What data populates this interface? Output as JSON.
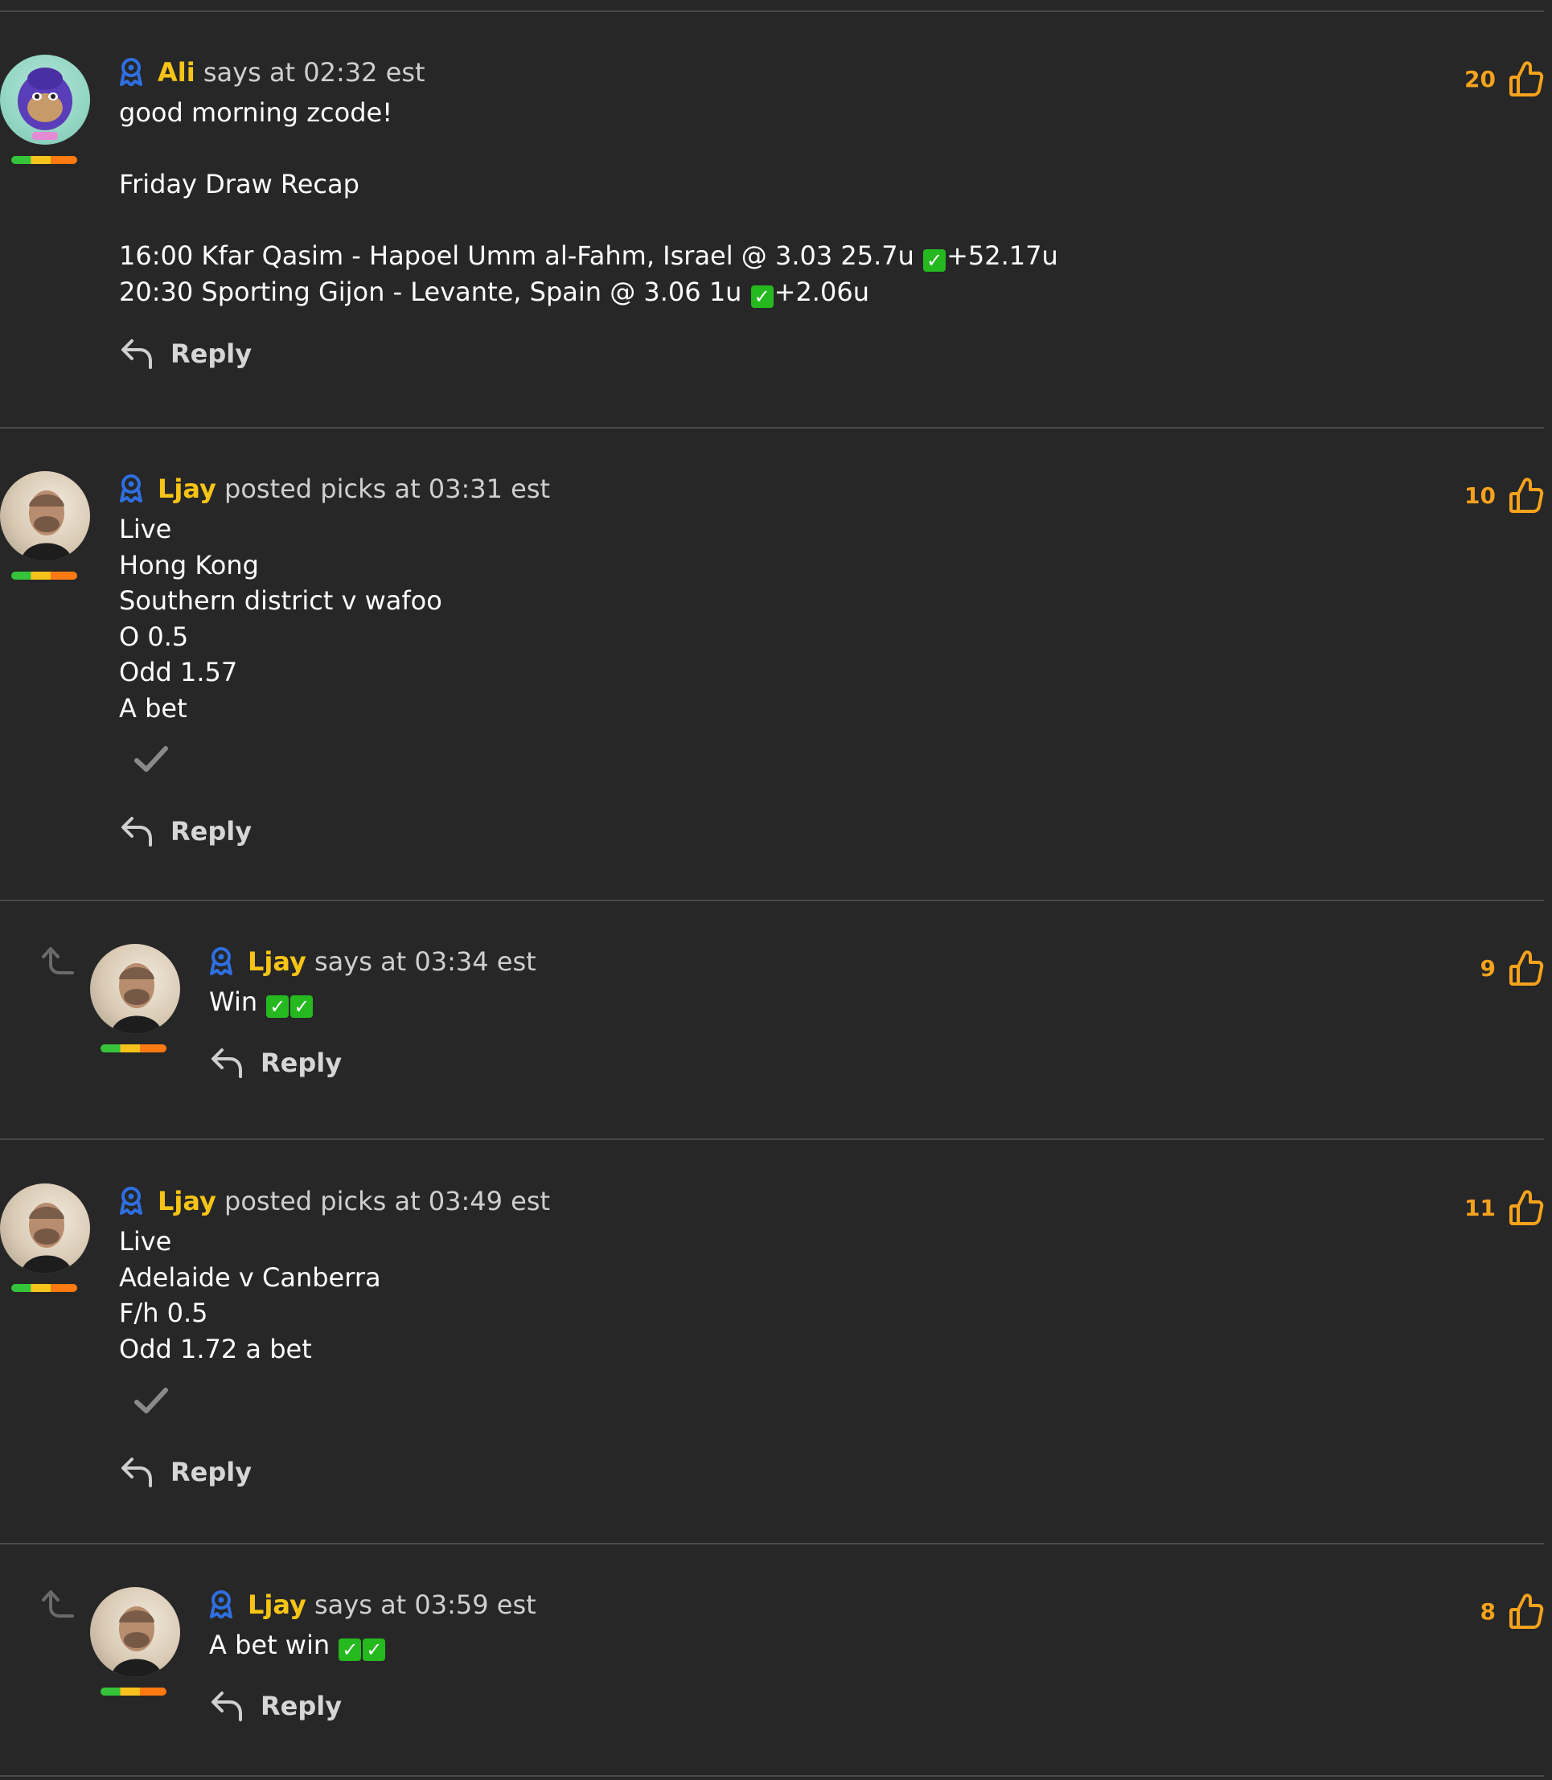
{
  "comments": [
    {
      "username": "Ali",
      "action": "says at 02:32 est",
      "lines": [
        "good morning zcode!",
        "",
        "Friday Draw Recap",
        "",
        {
          "text": "16:00 Kfar Qasim - Hapoel Umm al-Fahm, Israel @ 3.03 25.7u ",
          "checks": 1,
          "tail": "+52.17u"
        },
        {
          "text": "20:30 Sporting Gijon - Levante, Spain @ 3.06 1u ",
          "checks": 1,
          "tail": "+2.06u"
        }
      ],
      "likes": "20",
      "reply_label": "Reply"
    },
    {
      "username": "Ljay",
      "action": "posted picks at 03:31 est",
      "lines": [
        "Live",
        "Hong Kong",
        "Southern district v wafoo",
        "O 0.5",
        "Odd 1.57",
        "A bet"
      ],
      "likes": "10",
      "reply_label": "Reply"
    },
    {
      "username": "Ljay",
      "action": "says at 03:34 est",
      "lines": [
        {
          "text": "Win ",
          "checks": 2,
          "tail": ""
        }
      ],
      "likes": "9",
      "reply_label": "Reply"
    },
    {
      "username": "Ljay",
      "action": "posted picks at 03:49 est",
      "lines": [
        "Live",
        "Adelaide v Canberra",
        "F/h 0.5",
        "Odd 1.72 a bet"
      ],
      "likes": "11",
      "reply_label": "Reply"
    },
    {
      "username": "Ljay",
      "action": "says at 03:59 est",
      "lines": [
        {
          "text": "A bet win ",
          "checks": 2,
          "tail": ""
        }
      ],
      "likes": "8",
      "reply_label": "Reply"
    }
  ],
  "colors": {
    "background": "#272727",
    "username": "#f6c416",
    "likes": "#f6a21c",
    "badge": "#2f6fe0",
    "check_emoji": "#25b81f"
  }
}
